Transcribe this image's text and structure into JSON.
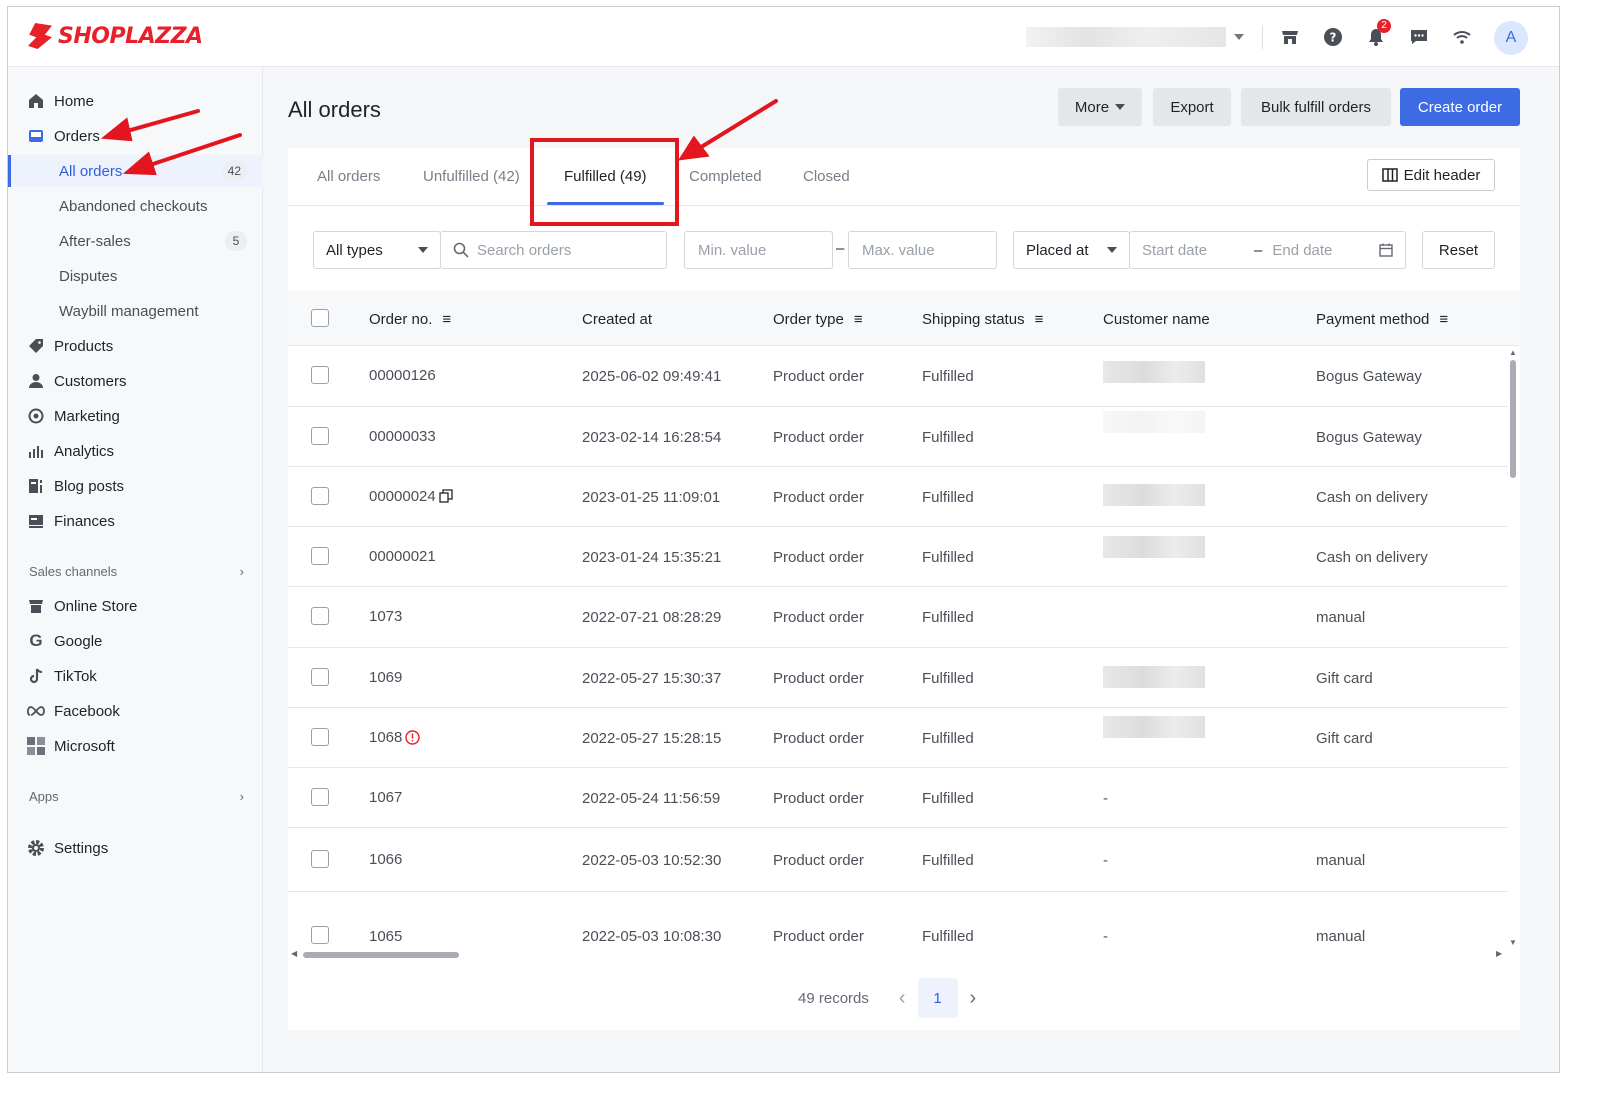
{
  "brand": {
    "name": "SHOPLAZZA",
    "color": "#e8202a"
  },
  "topbar": {
    "notification_count": "2",
    "avatar_letter": "A",
    "icons": [
      "store-icon",
      "help-icon",
      "bell-icon",
      "message-icon",
      "wifi-icon"
    ]
  },
  "sidebar": {
    "items": [
      {
        "label": "Home",
        "icon": "home-icon"
      },
      {
        "label": "Orders",
        "icon": "orders-icon"
      },
      {
        "label": "Products",
        "icon": "tag-icon"
      },
      {
        "label": "Customers",
        "icon": "person-icon"
      },
      {
        "label": "Marketing",
        "icon": "target-icon"
      },
      {
        "label": "Analytics",
        "icon": "bar-chart-icon"
      },
      {
        "label": "Blog posts",
        "icon": "blog-icon"
      },
      {
        "label": "Finances",
        "icon": "finance-icon"
      }
    ],
    "order_subitems": [
      {
        "label": "All orders",
        "count": "42"
      },
      {
        "label": "Abandoned checkouts",
        "count": ""
      },
      {
        "label": "After-sales",
        "count": "5"
      },
      {
        "label": "Disputes",
        "count": ""
      },
      {
        "label": "Waybill management",
        "count": ""
      }
    ],
    "sales_channels_label": "Sales channels",
    "channels": [
      {
        "label": "Online Store",
        "icon": "store-icon"
      },
      {
        "label": "Google",
        "icon": "google-icon"
      },
      {
        "label": "TikTok",
        "icon": "tiktok-icon"
      },
      {
        "label": "Facebook",
        "icon": "meta-icon"
      },
      {
        "label": "Microsoft",
        "icon": "microsoft-icon"
      }
    ],
    "apps_label": "Apps",
    "settings_label": "Settings"
  },
  "page": {
    "title": "All orders",
    "actions": {
      "more": "More",
      "export": "Export",
      "bulk": "Bulk fulfill orders",
      "create": "Create order"
    },
    "accent": "#3d6be3"
  },
  "tabs": [
    {
      "label": "All orders"
    },
    {
      "label": "Unfulfilled",
      "count": "(42)"
    },
    {
      "label": "Fulfilled",
      "count": "(49)"
    },
    {
      "label": "Completed"
    },
    {
      "label": "Closed"
    }
  ],
  "edit_header": "Edit header",
  "filters": {
    "type": "All types",
    "search_placeholder": "Search orders",
    "min_placeholder": "Min. value",
    "dash": "–",
    "max_placeholder": "Max. value",
    "date_field": "Placed at",
    "start_placeholder": "Start date",
    "end_placeholder": "End date",
    "reset": "Reset"
  },
  "columns": [
    "Order no.",
    "Created at",
    "Order type",
    "Shipping status",
    "Customer name",
    "Payment method"
  ],
  "rows": [
    {
      "order": "00000126",
      "created": "2025-06-02 09:49:41",
      "type": "Product order",
      "status": "Fulfilled",
      "customer": "",
      "payment": "Bogus Gateway"
    },
    {
      "order": "00000033",
      "created": "2023-02-14 16:28:54",
      "type": "Product order",
      "status": "Fulfilled",
      "customer": "",
      "payment": "Bogus Gateway"
    },
    {
      "order": "00000024",
      "created": "2023-01-25 11:09:01",
      "type": "Product order",
      "status": "Fulfilled",
      "customer": "",
      "payment": "Cash on delivery"
    },
    {
      "order": "00000021",
      "created": "2023-01-24 15:35:21",
      "type": "Product order",
      "status": "Fulfilled",
      "customer": "",
      "payment": "Cash on delivery"
    },
    {
      "order": "1073",
      "created": "2022-07-21 08:28:29",
      "type": "Product order",
      "status": "Fulfilled",
      "customer": "",
      "payment": "manual"
    },
    {
      "order": "1069",
      "created": "2022-05-27 15:30:37",
      "type": "Product order",
      "status": "Fulfilled",
      "customer": "",
      "payment": "Gift card"
    },
    {
      "order": "1068",
      "created": "2022-05-27 15:28:15",
      "type": "Product order",
      "status": "Fulfilled",
      "customer": "",
      "payment": "Gift card"
    },
    {
      "order": "1067",
      "created": "2022-05-24 11:56:59",
      "type": "Product order",
      "status": "Fulfilled",
      "customer": "-",
      "payment": ""
    },
    {
      "order": "1066",
      "created": "2022-05-03 10:52:30",
      "type": "Product order",
      "status": "Fulfilled",
      "customer": "-",
      "payment": "manual"
    },
    {
      "order": "1065",
      "created": "2022-05-03 10:08:30",
      "type": "Product order",
      "status": "Fulfilled",
      "customer": "-",
      "payment": "manual"
    }
  ],
  "pagination": {
    "records": "49 records",
    "current_page": "1"
  }
}
